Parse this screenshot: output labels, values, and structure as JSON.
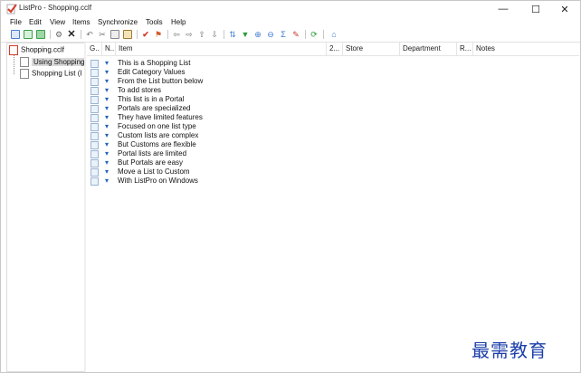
{
  "window": {
    "title": "ListPro - Shopping.cclf",
    "minimize_glyph": "—",
    "maximize_glyph": "☐",
    "close_glyph": "✕"
  },
  "menubar": {
    "items": [
      "File",
      "Edit",
      "View",
      "Items",
      "Synchronize",
      "Tools",
      "Help"
    ]
  },
  "toolbar": {
    "buttons": [
      {
        "icon": "new-list-icon",
        "color": "#4a7fd0"
      },
      {
        "icon": "open-icon",
        "color": "#3aa04a"
      },
      {
        "icon": "save-icon",
        "color": "#3aa04a"
      },
      {
        "icon": "settings-icon",
        "color": "#666666"
      },
      {
        "icon": "delete-icon",
        "color": "#222222"
      },
      {
        "icon": "undo-icon",
        "color": "#777777"
      },
      {
        "icon": "cut-icon",
        "color": "#777777"
      },
      {
        "icon": "copy-icon",
        "color": "#777777"
      },
      {
        "icon": "paste-icon",
        "color": "#a07a30"
      },
      {
        "icon": "check-icon",
        "color": "#d03a2a"
      },
      {
        "icon": "pin-icon",
        "color": "#d05a2a"
      },
      {
        "icon": "arrow-left-icon",
        "color": "#777777"
      },
      {
        "icon": "arrow-right-icon",
        "color": "#777777"
      },
      {
        "icon": "arrow-up-icon",
        "color": "#777777"
      },
      {
        "icon": "arrow-down-icon",
        "color": "#777777"
      },
      {
        "icon": "sort-icon",
        "color": "#3a7ad0"
      },
      {
        "icon": "filter-icon",
        "color": "#2a9a3a"
      },
      {
        "icon": "zoom-in-icon",
        "color": "#3a7ad0"
      },
      {
        "icon": "zoom-out-icon",
        "color": "#3a7ad0"
      },
      {
        "icon": "sum-icon",
        "color": "#3a7ad0"
      },
      {
        "icon": "edit-icon",
        "color": "#c03a2a"
      },
      {
        "icon": "sync-icon",
        "color": "#2a9a3a"
      },
      {
        "icon": "home-icon",
        "color": "#3a7ad0"
      }
    ]
  },
  "tree": {
    "root": "Shopping.cclf",
    "children": [
      "Using Shopping",
      "Shopping List (I"
    ]
  },
  "list": {
    "columns": [
      "G..",
      "N..",
      "Item",
      "2...",
      "Store",
      "Department",
      "R...",
      "Notes"
    ],
    "items": [
      "This is a Shopping List",
      "Edit Category Values",
      "From the List button below",
      "To add stores",
      "This list is in a Portal",
      "Portals are specialized",
      "They have limited features",
      "Focused on one list type",
      "Custom lists are complex",
      "But Customs are flexible",
      "Portal lists are limited",
      "But Portals are easy",
      "Move a List to Custom",
      "With ListPro on Windows"
    ],
    "pin_glyph": "▾"
  },
  "watermark": "最需教育"
}
